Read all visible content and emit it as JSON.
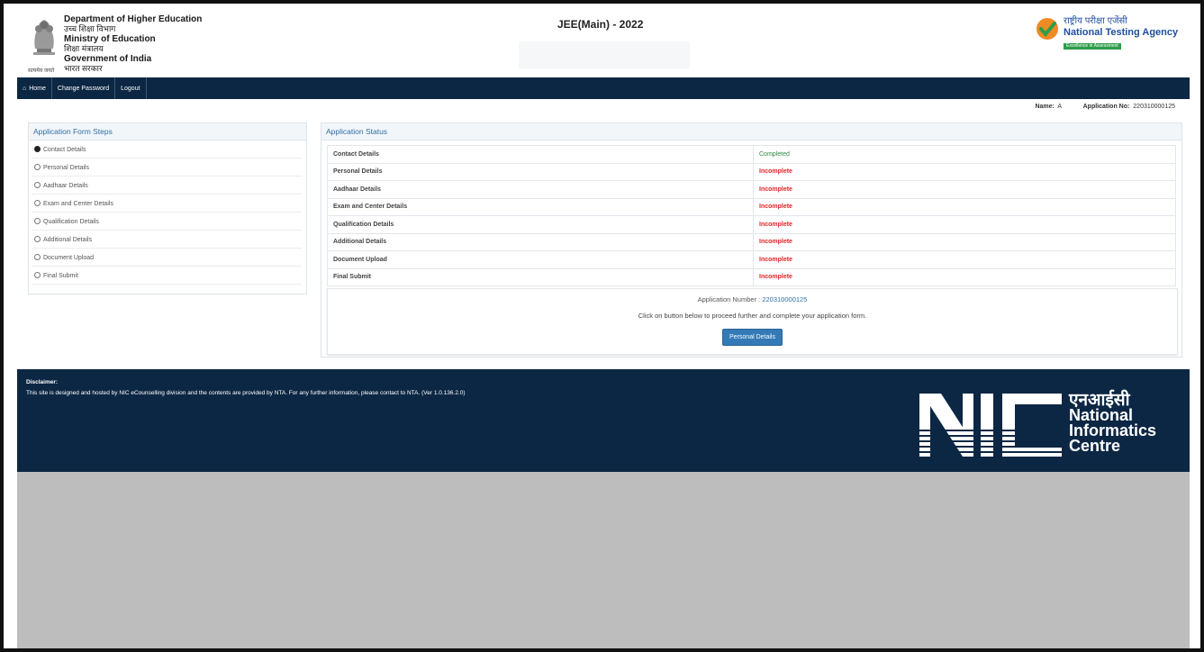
{
  "header": {
    "dept_lines": [
      {
        "text": "Department of Higher Education",
        "lang": "en"
      },
      {
        "text": "उच्च शिक्षा विभाग",
        "lang": "hi"
      },
      {
        "text": "Ministry of Education",
        "lang": "en"
      },
      {
        "text": "शिक्षा मंत्रालय",
        "lang": "hi"
      },
      {
        "text": "Government of India",
        "lang": "en"
      },
      {
        "text": "भारत सरकार",
        "lang": "hi"
      }
    ],
    "emblem_caption": "सत्यमेव जयते",
    "exam_title": "JEE(Main) - 2022",
    "nta_hindi": "राष्ट्रीय परीक्षा एजेंसी",
    "nta_name": "National Testing Agency",
    "nta_tagline": "Excellence in Assessment"
  },
  "nav": {
    "home": "Home",
    "change_password": "Change Password",
    "logout": "Logout",
    "home_icon": "home-icon"
  },
  "user": {
    "name_label": "Name:",
    "name_value": "A",
    "app_label": "Application No:",
    "app_value": "220310000125"
  },
  "steps": {
    "title": "Application Form Steps",
    "items": [
      {
        "label": "Contact Details",
        "done": true
      },
      {
        "label": "Personal Details",
        "done": false
      },
      {
        "label": "Aadhaar Details",
        "done": false
      },
      {
        "label": "Exam and Center Details",
        "done": false
      },
      {
        "label": "Qualification Details",
        "done": false
      },
      {
        "label": "Additional Details",
        "done": false
      },
      {
        "label": "Document Upload",
        "done": false
      },
      {
        "label": "Final Submit",
        "done": false
      }
    ]
  },
  "status": {
    "title": "Application Status",
    "rows": [
      {
        "section": "Contact Details",
        "status": "Completed"
      },
      {
        "section": "Personal Details",
        "status": "Incomplete"
      },
      {
        "section": "Aadhaar Details",
        "status": "Incomplete"
      },
      {
        "section": "Exam and Center Details",
        "status": "Incomplete"
      },
      {
        "section": "Qualification Details",
        "status": "Incomplete"
      },
      {
        "section": "Additional Details",
        "status": "Incomplete"
      },
      {
        "section": "Document Upload",
        "status": "Incomplete"
      },
      {
        "section": "Final Submit",
        "status": "Incomplete"
      }
    ],
    "app_number_label": "Application Number :",
    "app_number": "220310000125",
    "proceed_text": "Click on button below to proceed further and complete your application form.",
    "button_label": "Personal Details"
  },
  "footer": {
    "disclaimer_title": "Disclaimer:",
    "disclaimer_text": "This site is designed and hosted by NIC eCounselling division and the contents are provided by NTA. For any further information, please contact to NTA. (Ver 1.0.136.2.0)",
    "nic_hindi": "एनआईसी",
    "nic_lines": [
      "National",
      "Informatics",
      "Centre"
    ]
  },
  "colors": {
    "navy": "#0c2744",
    "link_blue": "#2d6fa8",
    "complete_green": "#2b8a3e",
    "incomplete_red": "#e02626",
    "button_blue": "#337ab7",
    "grey_area": "#bdbdbd"
  }
}
